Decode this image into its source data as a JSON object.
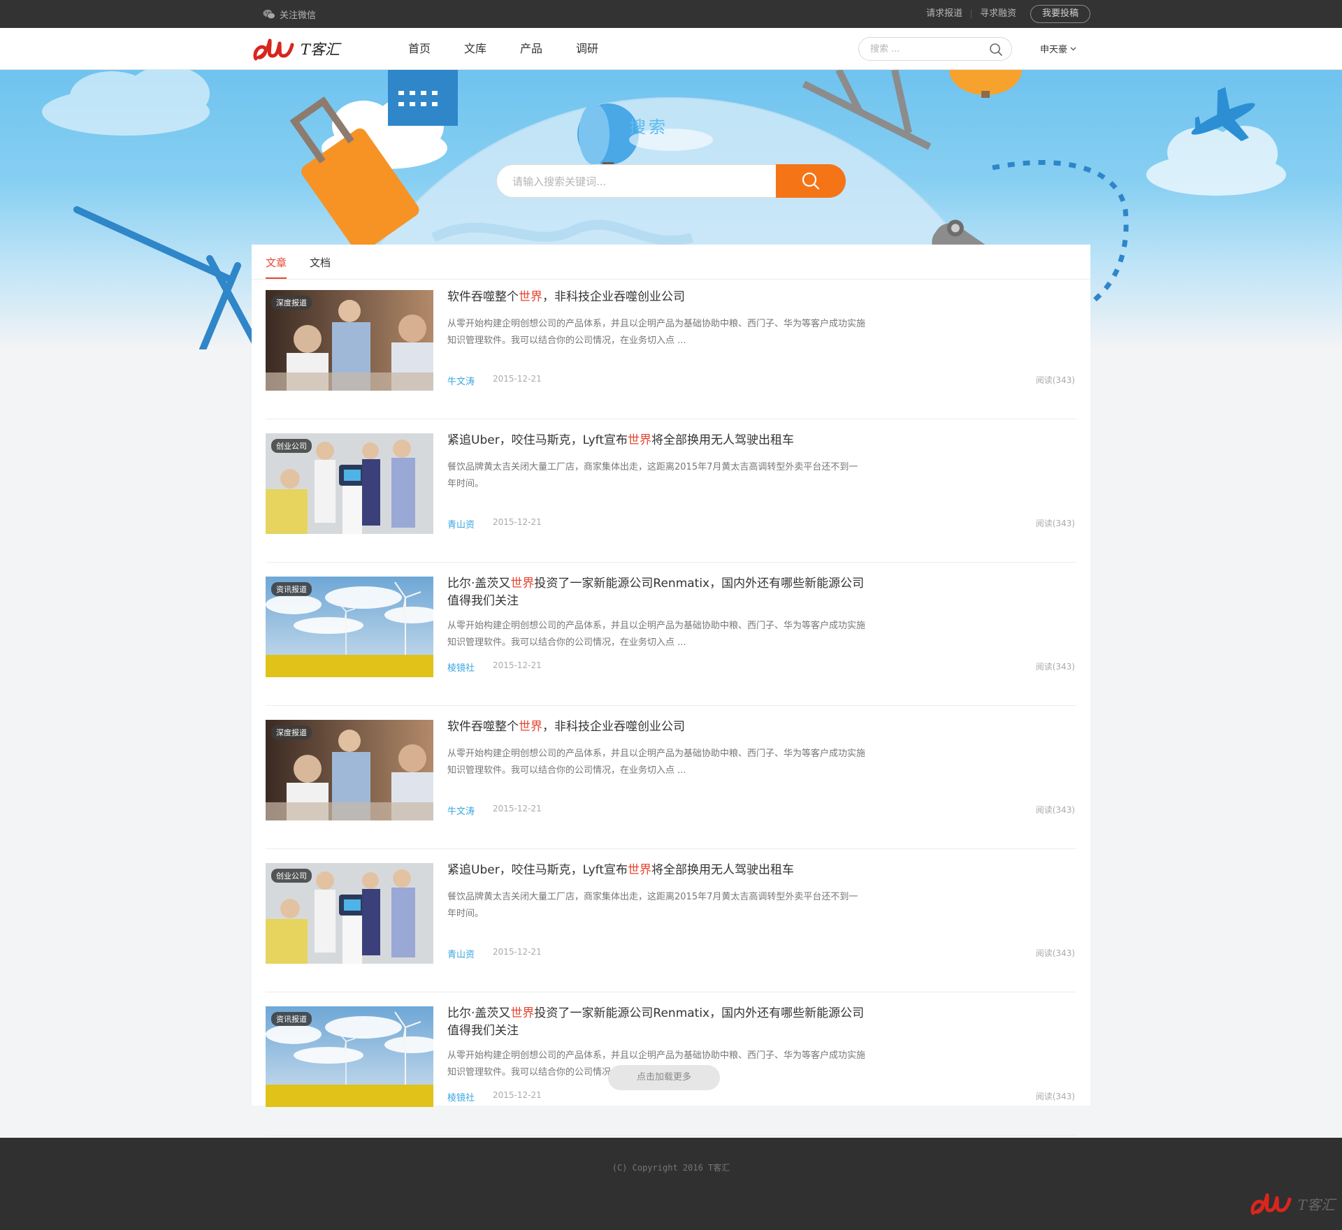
{
  "topbar": {
    "wechat": "关注微信",
    "links": [
      "请求报道",
      "寻求融资"
    ],
    "submit": "我要投稿"
  },
  "nav": {
    "logo_text": "T客汇",
    "items": [
      "首页",
      "文库",
      "产品",
      "调研"
    ],
    "search_placeholder": "搜索 ...",
    "user": "申天豪"
  },
  "hero": {
    "title": "搜索",
    "search_placeholder": "请输入搜索关键词..."
  },
  "tabs": [
    "文章",
    "文档"
  ],
  "articles": [
    {
      "badge": "深度报道",
      "title_pre": "软件吞噬整个",
      "title_hl": "世界",
      "title_post": "，非科技企业吞噬创业公司",
      "desc": "从零开始构建企明创想公司的产品体系，并且以企明产品为基础协助中粮、西门子、华为等客户成功实施知识管理软件。我可以结合你的公司情况，在业务切入点 ...",
      "author": "牛文涛",
      "date": "2015-12-21",
      "reads": "阅读(343)"
    },
    {
      "badge": "创业公司",
      "title_pre": "紧追Uber，咬住马斯克，Lyft宣布",
      "title_hl": "世界",
      "title_post": "将全部换用无人驾驶出租车",
      "desc": "餐饮品牌黄太吉关闭大量工厂店，商家集体出走，这距离2015年7月黄太吉高调转型外卖平台还不到一年时间。",
      "author": "青山资",
      "date": "2015-12-21",
      "reads": "阅读(343)"
    },
    {
      "badge": "资讯报道",
      "title_pre": "比尔·盖茨又",
      "title_hl": "世界",
      "title_post": "投资了一家新能源公司Renmatix，国内外还有哪些新能源公司值得我们关注",
      "desc": "从零开始构建企明创想公司的产品体系，并且以企明产品为基础协助中粮、西门子、华为等客户成功实施知识管理软件。我可以结合你的公司情况，在业务切入点 ...",
      "author": "棱镜社",
      "date": "2015-12-21",
      "reads": "阅读(343)"
    },
    {
      "badge": "深度报道",
      "title_pre": "软件吞噬整个",
      "title_hl": "世界",
      "title_post": "，非科技企业吞噬创业公司",
      "desc": "从零开始构建企明创想公司的产品体系，并且以企明产品为基础协助中粮、西门子、华为等客户成功实施知识管理软件。我可以结合你的公司情况，在业务切入点 ...",
      "author": "牛文涛",
      "date": "2015-12-21",
      "reads": "阅读(343)"
    },
    {
      "badge": "创业公司",
      "title_pre": "紧追Uber，咬住马斯克，Lyft宣布",
      "title_hl": "世界",
      "title_post": "将全部换用无人驾驶出租车",
      "desc": "餐饮品牌黄太吉关闭大量工厂店，商家集体出走，这距离2015年7月黄太吉高调转型外卖平台还不到一年时间。",
      "author": "青山资",
      "date": "2015-12-21",
      "reads": "阅读(343)"
    },
    {
      "badge": "资讯报道",
      "title_pre": "比尔·盖茨又",
      "title_hl": "世界",
      "title_post": "投资了一家新能源公司Renmatix，国内外还有哪些新能源公司值得我们关注",
      "desc": "从零开始构建企明创想公司的产品体系，并且以企明产品为基础协助中粮、西门子、华为等客户成功实施知识管理软件。我可以结合你的公司情况，在业务切入点 ...",
      "author": "棱镜社",
      "date": "2015-12-21",
      "reads": "阅读(343)"
    }
  ],
  "load_more": "点击加载更多",
  "footer": {
    "copyright": "(C) Copyright 2016 T客汇",
    "logo_text": "T客汇"
  },
  "colors": {
    "accent": "#e8442f",
    "search_button": "#f57416",
    "author_link": "#39a6e0",
    "topbar": "#333333",
    "footer": "#303030"
  },
  "icons": {
    "wechat": "wechat-icon",
    "search": "search-icon",
    "dropdown": "chevron-down-icon",
    "logo": "logo-mark-icon"
  }
}
